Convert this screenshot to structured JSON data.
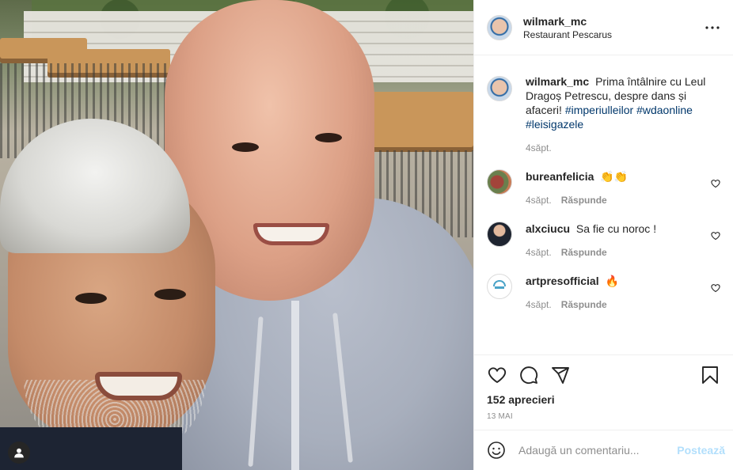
{
  "post": {
    "username": "wilmark_mc",
    "location": "Restaurant Pescarus",
    "caption": {
      "username": "wilmark_mc",
      "text": "Prima întâlnire cu Leul Dragoș Petrescu, despre dans și afaceri!",
      "hashtags": [
        "#imperiulleilor",
        "#wdaonline",
        "#leisigazele"
      ],
      "time": "4săpt."
    },
    "comments": [
      {
        "username": "bureanfelicia",
        "text": "👏👏",
        "time": "4săpt.",
        "reply": "Răspunde"
      },
      {
        "username": "alxciucu",
        "text": "Sa fie cu noroc !",
        "time": "4săpt.",
        "reply": "Răspunde"
      },
      {
        "username": "artpresofficial",
        "text": "🔥",
        "time": "4săpt.",
        "reply": "Răspunde"
      }
    ],
    "likes_text": "152 aprecieri",
    "date": "13 MAI",
    "add_comment_placeholder": "Adaugă un comentariu...",
    "post_button_label": "Postează"
  },
  "icons": {
    "more": "more-horizontal-icon",
    "heart": "heart-icon",
    "comment": "comment-icon",
    "share": "paper-plane-icon",
    "save": "bookmark-icon",
    "emoji": "smiley-icon",
    "user_tag": "user-tag-icon"
  },
  "colors": {
    "text": "#262626",
    "muted": "#8e8e8e",
    "hashtag": "#00376b",
    "post_button_disabled": "#b2dffc",
    "border": "#efefef"
  }
}
